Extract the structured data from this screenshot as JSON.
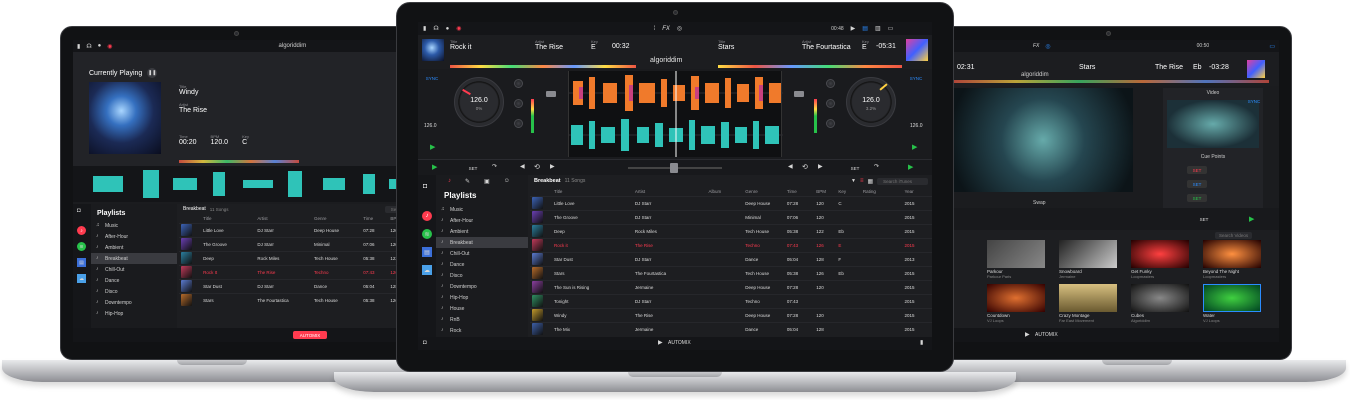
{
  "brand": "algoriddim",
  "center": {
    "deckA": {
      "label_title": "Title",
      "title": "Rock it",
      "label_artist": "Artist",
      "artist": "The Rise",
      "label_key": "Key",
      "key": "E",
      "time": "00:32",
      "bpm": "126.0",
      "pct": "0%"
    },
    "deckB": {
      "label_title": "Title",
      "title": "Stars",
      "label_artist": "Artist",
      "artist": "The Fourtastica",
      "label_key": "Key",
      "key": "E",
      "time": "-05:31",
      "bpm": "126.0",
      "pct": "3.2%"
    },
    "clock": "00:48",
    "fx_label": "FX",
    "sync": "SYNC",
    "set": "SET",
    "pitch_left": "126.0",
    "pitch_left_pct": "0%",
    "pitch_right": "126.0",
    "pitch_right_pct": "3.2%",
    "playlist_header": "Breakbeat",
    "song_count": "11 Songs",
    "search_placeholder": "Search iTunes",
    "playlists_title": "Playlists",
    "playlists": [
      "Music",
      "After-Hour",
      "Ambient",
      "Breakbeat",
      "Chill-Out",
      "Dance",
      "Disco",
      "Downtempo",
      "Hip-Hop",
      "House",
      "RnB",
      "Rock"
    ],
    "columns": [
      "Title",
      "Artist",
      "Album",
      "Genre",
      "Time",
      "BPM",
      "Key",
      "Rating",
      "Year"
    ],
    "tracks": [
      [
        "Little Love",
        "DJ Starr",
        "",
        "Deep House",
        "07:28",
        "120",
        "C",
        "",
        "2015"
      ],
      [
        "The Groove",
        "DJ Starr",
        "",
        "Minimal",
        "07:06",
        "120",
        "",
        "",
        "2015"
      ],
      [
        "Deep",
        "Rock Miles",
        "",
        "Tech House",
        "05:38",
        "122",
        "Eb",
        "",
        "2015"
      ],
      [
        "Rock it",
        "The Rise",
        "",
        "Techno",
        "07:43",
        "126",
        "E",
        "",
        "2015"
      ],
      [
        "Star Dust",
        "DJ Starr",
        "",
        "Dance",
        "05:04",
        "128",
        "F",
        "",
        "2013"
      ],
      [
        "Stars",
        "The Fourtastica",
        "",
        "Tech House",
        "05:38",
        "126",
        "Eb",
        "",
        "2015"
      ],
      [
        "The Sun is Rising",
        "Jermaine",
        "",
        "Deep House",
        "07:28",
        "120",
        "",
        "",
        "2015"
      ],
      [
        "Tonight",
        "DJ Starr",
        "",
        "Techno",
        "07:43",
        "",
        "",
        "",
        "2015"
      ],
      [
        "Windy",
        "The Rise",
        "",
        "Deep House",
        "07:28",
        "120",
        "",
        "",
        "2015"
      ],
      [
        "The Mix",
        "Jermaine",
        "",
        "Dance",
        "05:04",
        "128",
        "",
        "",
        "2015"
      ]
    ],
    "automix": "AUTOMIX"
  },
  "left": {
    "currently_playing": "Currently Playing",
    "label_title": "Title",
    "title": "Windy",
    "label_artist": "Artist",
    "artist": "The Rise",
    "label_time": "Time",
    "time": "00:20",
    "label_bpm": "BPM",
    "bpm": "120.0",
    "label_key": "Key",
    "key": "C",
    "playlist_header": "Breakbeat",
    "song_count": "11 Songs",
    "playlists_title": "Playlists",
    "playlists": [
      "Music",
      "After-Hour",
      "Ambient",
      "Breakbeat",
      "Chill-Out",
      "Dance",
      "Disco",
      "Downtempo",
      "Hip-Hop"
    ],
    "columns": [
      "Title",
      "Artist",
      "Genre",
      "Time",
      "BPM"
    ],
    "tracks": [
      [
        "Little Love",
        "DJ Starr",
        "Deep House",
        "07:28",
        "120"
      ],
      [
        "The Groove",
        "DJ Starr",
        "Minimal",
        "07:06",
        "120"
      ],
      [
        "Deep",
        "Rock Miles",
        "Tech House",
        "05:38",
        "122"
      ],
      [
        "Rock It",
        "The Rise",
        "Techno",
        "07:43",
        "126"
      ],
      [
        "Star Dust",
        "DJ Starr",
        "Dance",
        "05:04",
        "128"
      ],
      [
        "Stars",
        "The Fourtastica",
        "Tech House",
        "05:38",
        "126"
      ]
    ],
    "search_placeholder": "Search",
    "automix": "AUTOMIX"
  },
  "right": {
    "clock": "00:50",
    "fx_label": "FX",
    "time_left": "02:31",
    "deckB": {
      "title": "The Rise",
      "artist": "The Fourtastica",
      "key": "Eb",
      "time": "-03:28"
    },
    "deckA_title": "Stars",
    "video_label": "Video",
    "sync": "SYNC",
    "cue_points": "Cue Points",
    "set": "SET",
    "swap": "Swap",
    "search_placeholder": "Search Videos",
    "videos_row1": [
      {
        "title": "Parkour",
        "sub": "Parkour Paris"
      },
      {
        "title": "Snowboard",
        "sub": "Jermaine"
      },
      {
        "title": "Get Funky",
        "sub": "Loopmasters"
      },
      {
        "title": "Beyond The Night",
        "sub": "Loopmasters"
      }
    ],
    "videos_row2": [
      {
        "title": "Countdown",
        "sub": "VJ Loops"
      },
      {
        "title": "Crazy Montage",
        "sub": "Far East Movement"
      },
      {
        "title": "Cubes",
        "sub": "Algoriddim"
      },
      {
        "title": "Water",
        "sub": "VJ Loops"
      }
    ],
    "automix": "AUTOMIX"
  },
  "colors": {
    "accent_red": "#ff3b4f",
    "accent_blue": "#2b8cff",
    "accent_green": "#27c24a",
    "panel": "#1b1c1f"
  }
}
